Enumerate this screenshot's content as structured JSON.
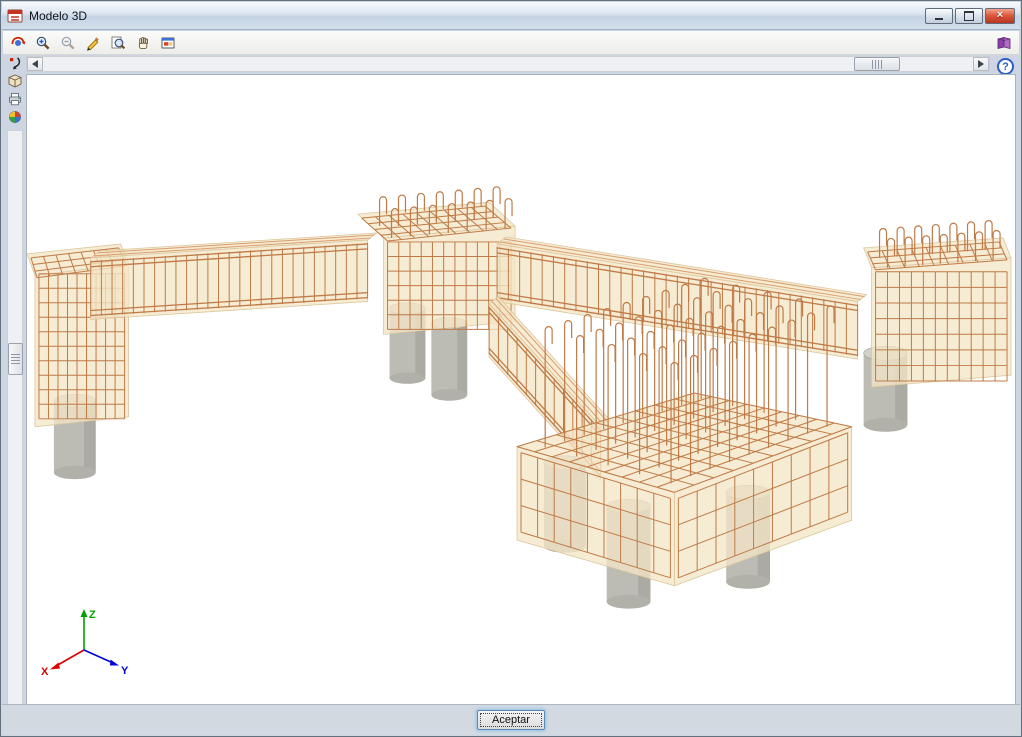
{
  "window": {
    "title": "Modelo 3D"
  },
  "titlebar_controls": [
    {
      "name": "minimize"
    },
    {
      "name": "maximize"
    },
    {
      "name": "close"
    }
  ],
  "toolbar": {
    "icons": [
      "rotate-view",
      "zoom-in",
      "zoom-out",
      "measure",
      "zoom-extents",
      "pan",
      "window-view"
    ],
    "right_icon": "views"
  },
  "left_toolbar": {
    "icons": [
      "previous-view",
      "solid-view",
      "print",
      "render-view"
    ]
  },
  "help": {
    "glyph": "?"
  },
  "scrollbars": {
    "horizontal": {
      "thumb_position": "right"
    },
    "vertical": {
      "thumb_position": "middle"
    }
  },
  "axis_indicator": {
    "x": "X",
    "y": "Y",
    "z": "Z",
    "x_color": "#dd0000",
    "y_color": "#0000dd",
    "z_color": "#00a000"
  },
  "footer": {
    "accept_label": "Aceptar"
  },
  "scene": {
    "description": "3D model of reinforced-concrete pile caps joined by tie beams: translucent beige concrete volumes, copper rebar cages with hooked vertical bars, grey cylindrical piles below",
    "colors": {
      "concrete": "rgba(243,229,198,0.78)",
      "concrete_edge": "#dcc79e",
      "rebar": "#bf7a46",
      "rebar_light": "#d99e6e",
      "pile": "#bcbcb4",
      "pile_dark": "#9d9d95",
      "pile_top": "#d2d2ca"
    }
  }
}
